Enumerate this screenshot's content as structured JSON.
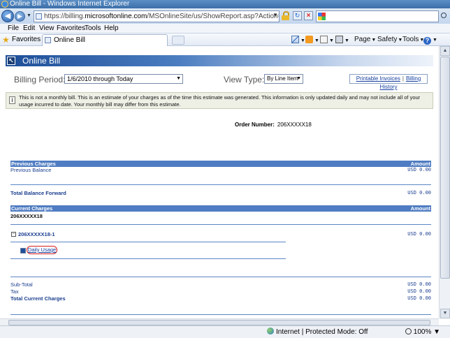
{
  "window": {
    "title": "Online Bill - Windows Internet Explorer"
  },
  "address": {
    "prefix": "https://billing.",
    "host": "microsoftonline.com",
    "path": "/MSOnlineSite/us/ShowReport.asp?Action=SHOWLEVEL&repo"
  },
  "menu": [
    "File",
    "Edit",
    "View",
    "Favorites",
    "Tools",
    "Help"
  ],
  "favbar": {
    "favorites": "Favorites",
    "tab": "Online Bill"
  },
  "commands": {
    "page": "Page",
    "safety": "Safety",
    "tools": "Tools"
  },
  "page": {
    "title": "Online Bill",
    "billing_period_label": "Billing Period:",
    "billing_period_value": "1/6/2010 through Today",
    "view_type_label": "View Type:",
    "view_type_value": "By Line Item",
    "links": {
      "printable": "Printable Invoices",
      "history": "Billing History",
      "separator": "|"
    },
    "notice": "This is not a monthly bill. This is an estimate of your charges as of the time this estimate was generated. This information is only updated daily and may not include all of your usage incurred to date. Your monthly bill may differ from this estimate.",
    "order_number_label": "Order Number:",
    "order_number_value": "206XXXXX18"
  },
  "previous": {
    "header": "Previous Charges",
    "amount_header": "Amount",
    "balance_label": "Previous Balance",
    "balance_amount": "USD  0.00",
    "forward_label": "Total Balance Forward",
    "forward_amount": "USD  0.00"
  },
  "current": {
    "header": "Current Charges",
    "amount_header": "Amount",
    "order_id": "206XXXXX18",
    "expand": "−",
    "sub_id": "206XXXXX18-1",
    "sub_amount": "USD  0.00",
    "daily_usage": "Daily Usage",
    "subtotal_label": "Sub-Total",
    "subtotal_amount": "USD  0.00",
    "tax_label": "Tax",
    "tax_amount": "USD  0.00",
    "total_label": "Total Current Charges",
    "total_amount": "USD  0.00"
  },
  "status": {
    "zone": "Internet | Protected Mode: Off",
    "zoom": "100%"
  },
  "colors": {
    "section_bar": "#4f7cc2",
    "link": "#1740a0",
    "highlight_circle": "#d41c1c"
  }
}
